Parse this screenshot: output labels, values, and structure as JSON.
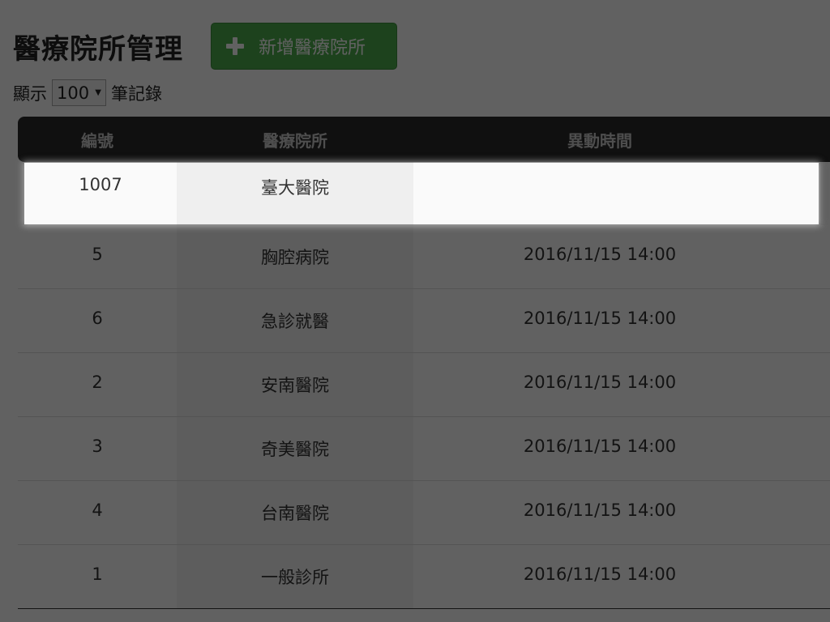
{
  "page": {
    "title": "醫療院所管理",
    "add_button_label": "新增醫療院所"
  },
  "length_control": {
    "prefix": "顯示",
    "selected": "100",
    "suffix": "筆記錄"
  },
  "table": {
    "headers": [
      "編號",
      "醫療院所",
      "異動時間"
    ],
    "highlighted_row": {
      "id": "1007",
      "name": "臺大醫院",
      "time": ""
    },
    "rows": [
      {
        "id": "5",
        "name": "胸腔病院",
        "time": "2016/11/15 14:00"
      },
      {
        "id": "6",
        "name": "急診就醫",
        "time": "2016/11/15 14:00"
      },
      {
        "id": "2",
        "name": "安南醫院",
        "time": "2016/11/15 14:00"
      },
      {
        "id": "3",
        "name": "奇美醫院",
        "time": "2016/11/15 14:00"
      },
      {
        "id": "4",
        "name": "台南醫院",
        "time": "2016/11/15 14:00"
      },
      {
        "id": "1",
        "name": "一般診所",
        "time": "2016/11/15 14:00"
      }
    ]
  },
  "icons": {
    "add": "plus-icon"
  },
  "colors": {
    "add_button": "#4cae4c",
    "header_bg": "#2a2a2a"
  }
}
